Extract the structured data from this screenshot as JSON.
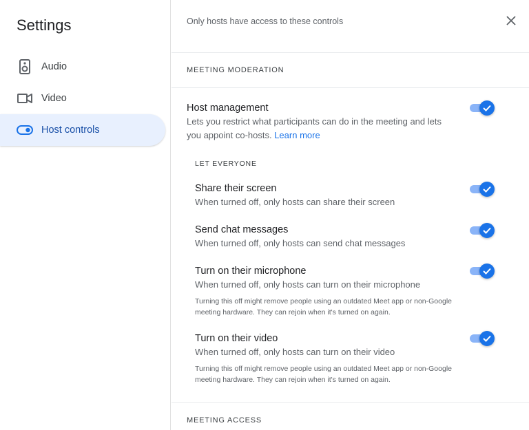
{
  "sidebar": {
    "title": "Settings",
    "items": [
      {
        "label": "Audio",
        "icon": "speaker-icon"
      },
      {
        "label": "Video",
        "icon": "video-camera-icon"
      },
      {
        "label": "Host controls",
        "icon": "toggle-icon",
        "active": true
      }
    ]
  },
  "main": {
    "header_note": "Only hosts have access to these controls",
    "sections": {
      "moderation_title": "MEETING MODERATION",
      "access_title": "MEETING ACCESS"
    },
    "host_management": {
      "title": "Host management",
      "desc": "Lets you restrict what participants can do in the meeting and lets you appoint co-hosts.",
      "link": "Learn more",
      "enabled": true
    },
    "let_everyone_title": "LET EVERYONE",
    "settings": [
      {
        "title": "Share their screen",
        "desc": "When turned off, only hosts can share their screen",
        "enabled": true
      },
      {
        "title": "Send chat messages",
        "desc": "When turned off, only hosts can send chat messages",
        "enabled": true
      },
      {
        "title": "Turn on their microphone",
        "desc": "When turned off, only hosts can turn on their microphone",
        "note": "Turning this off might remove people using an outdated Meet app or non-Google meeting hardware. They can rejoin when it's turned on again.",
        "enabled": true
      },
      {
        "title": "Turn on their video",
        "desc": "When turned off, only hosts can turn on their video",
        "note": "Turning this off might remove people using an outdated Meet app or non-Google meeting hardware. They can rejoin when it's turned on again.",
        "enabled": true
      }
    ]
  },
  "colors": {
    "accent": "#1a73e8",
    "accent_light": "#8ab4f8",
    "active_nav_bg": "#e8f0fe"
  }
}
